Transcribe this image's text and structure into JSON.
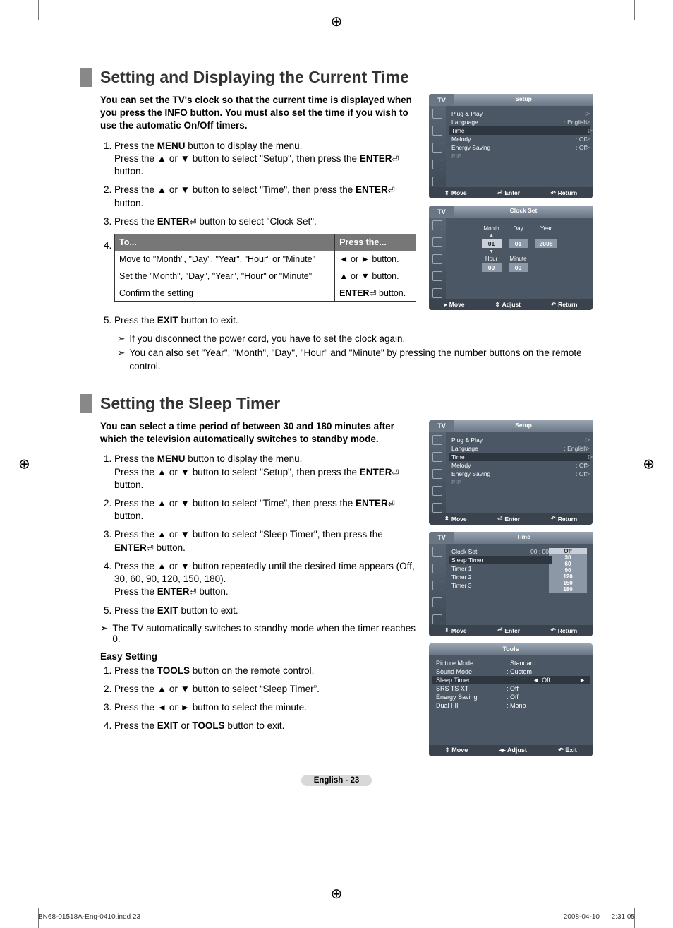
{
  "section1": {
    "title": "Setting and Displaying the Current Time",
    "intro": "You can set the TV's clock so that the current time is displayed when you press the INFO button. You must also set the time if you wish to use the automatic On/Off timers.",
    "step1a": "Press the ",
    "step1b": " button to display the menu.",
    "step1c": "Press the ▲ or ▼ button to select \"Setup\", then press the ",
    "step1d": " button.",
    "step2a": "Press the ▲ or ▼ button to select \"Time\", then press the ",
    "step2b": " button.",
    "step3a": "Press the ",
    "step3b": " button to select \"Clock Set\".",
    "table": {
      "h1": "To...",
      "h2": "Press the...",
      "r1c1": "Move to \"Month\", \"Day\", \"Year\", \"Hour\" or \"Minute\"",
      "r1c2": "◄ or ► button.",
      "r2c1": "Set the \"Month\", \"Day\", \"Year\", \"Hour\" or \"Minute\"",
      "r2c2": "▲ or ▼ button.",
      "r3c1": "Confirm the setting",
      "r3c2": " button."
    },
    "step5a": "Press the ",
    "step5b": " button to exit.",
    "note1": "If you disconnect the power cord, you have to set the clock again.",
    "note2": "You can also set \"Year\", \"Month\", \"Day\", \"Hour\" and \"Minute\" by pressing the number buttons on the remote control."
  },
  "section2": {
    "title": "Setting the Sleep Timer",
    "intro": "You can select a time period of between 30 and 180 minutes after which the television automatically switches to standby mode.",
    "step1a": "Press the ",
    "step1b": " button to display the menu.",
    "step1c": "Press the ▲ or ▼ button to select \"Setup\", then press the ",
    "step1d": " button.",
    "step2a": "Press the ▲ or ▼ button to select \"Time\", then press the ",
    "step2b": " button.",
    "step3a": "Press the ▲ or ▼ button to select \"Sleep Timer\", then press the ",
    "step3b": " button.",
    "step4a": "Press the ▲ or ▼ button repeatedly until the desired time appears (Off, 30, 60, 90, 120, 150, 180).",
    "step4b": "Press the ",
    "step4c": " button.",
    "step5a": "Press the ",
    "step5b": " button to exit.",
    "autonote": "The TV automatically switches to standby mode when the timer reaches 0.",
    "easy_h": "Easy Setting",
    "e1a": "Press the ",
    "e1b": " button on the remote control.",
    "e2": "Press the ▲ or ▼ button to select “Sleep Timer”.",
    "e3": "Press the ◄ or ► button to select the minute.",
    "e4a": "Press the ",
    "e4b": " or ",
    "e4c": " button to exit."
  },
  "labels": {
    "menu": "MENU",
    "enter": "ENTER",
    "exit": "EXIT",
    "tools": "TOOLS"
  },
  "osd": {
    "tv": "TV",
    "setup": "Setup",
    "clockset": "Clock Set",
    "time": "Time",
    "tools": "Tools",
    "move": "Move",
    "enter": "Enter",
    "return": "Return",
    "adjust": "Adjust",
    "exit": "Exit",
    "setup_rows": {
      "r1": "Plug & Play",
      "r2": "Language",
      "r2v": ": English",
      "r3": "Time",
      "r4": "Melody",
      "r4v": ": Off",
      "r5": "Energy Saving",
      "r5v": ": Off",
      "r6": "PIP"
    },
    "clock": {
      "month": "Month",
      "day": "Day",
      "year": "Year",
      "hour": "Hour",
      "minute": "Minute",
      "v_month": "01",
      "v_day": "01",
      "v_year": "2008",
      "v_hour": "00",
      "v_minute": "00"
    },
    "time_rows": {
      "r1": "Clock Set",
      "r1v": ": 00 : 00",
      "r2": "Sleep Timer",
      "r3": "Timer 1",
      "r4": "Timer 2",
      "r5": "Timer 3"
    },
    "sleep_opts": {
      "o0": "Off",
      "o1": "30",
      "o2": "60",
      "o3": "90",
      "o4": "120",
      "o5": "150",
      "o6": "180"
    },
    "tools_rows": {
      "r1": "Picture Mode",
      "r1v": ": Standard",
      "r2": "Sound Mode",
      "r2v": ": Custom",
      "r3": "Sleep Timer",
      "r3v": "Off",
      "r4": "SRS TS XT",
      "r4v": ": Off",
      "r5": "Energy Saving",
      "r5v": ": Off",
      "r6": "Dual I-II",
      "r6v": ": Mono"
    }
  },
  "footer": {
    "page": "English - 23"
  },
  "meta": {
    "left": "BN68-01518A-Eng-0410.indd   23",
    "right": "2008-04-10      2:31:05"
  }
}
